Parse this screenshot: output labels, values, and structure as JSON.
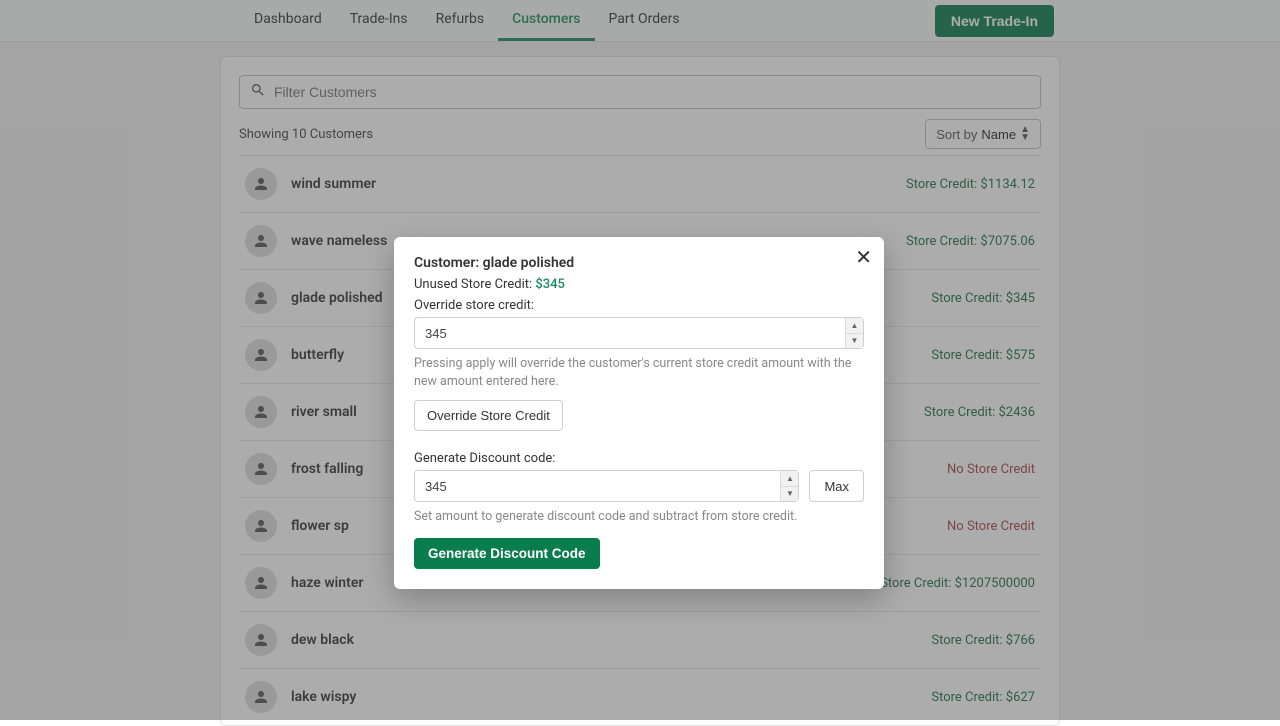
{
  "nav": {
    "tabs": [
      "Dashboard",
      "Trade-Ins",
      "Refurbs",
      "Customers",
      "Part Orders"
    ],
    "active_index": 3,
    "new_tradein": "New Trade-In"
  },
  "search": {
    "placeholder": "Filter Customers"
  },
  "meta": {
    "count_text": "Showing 10 Customers",
    "sort_prefix": "Sort by ",
    "sort_field": "Name"
  },
  "credit_label_prefix": "Store Credit: ",
  "no_credit_label": "No Store Credit",
  "customers": [
    {
      "name": "wind summer",
      "credit": "$1134.12"
    },
    {
      "name": "wave nameless",
      "credit": "$7075.06"
    },
    {
      "name": "glade polished",
      "credit": "$345"
    },
    {
      "name": "butterfly",
      "credit": "$575"
    },
    {
      "name": "river small",
      "credit": "$2436"
    },
    {
      "name": "frost falling",
      "credit": null
    },
    {
      "name": "flower sp",
      "credit": null
    },
    {
      "name": "haze winter",
      "credit": "$1207500000"
    },
    {
      "name": "dew black",
      "credit": "$766"
    },
    {
      "name": "lake wispy",
      "credit": "$627"
    }
  ],
  "modal": {
    "title_prefix": "Customer: ",
    "customer_name": "glade polished",
    "unused_label": "Unused Store Credit: ",
    "unused_value": "$345",
    "override_label": "Override store credit:",
    "override_value": "345",
    "override_help": "Pressing apply will override the customer's current store credit amount with the new amount entered here.",
    "override_btn": "Override Store Credit",
    "generate_label": "Generate Discount code:",
    "generate_value": "345",
    "max_btn": "Max",
    "generate_help": "Set amount to generate discount code and subtract from store credit.",
    "generate_btn": "Generate Discount Code"
  }
}
